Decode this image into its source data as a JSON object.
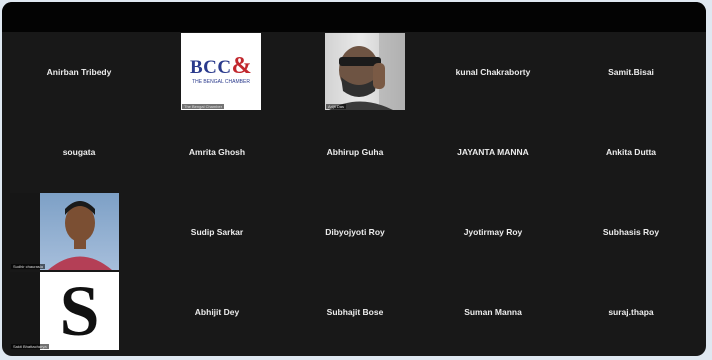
{
  "participants": [
    {
      "name": "Anirban Tribedy"
    },
    {
      "name": "",
      "caption": "The Bengal Chamber",
      "logo_text": "BCC",
      "logo_sub": "THE BENGAL CHAMBER"
    },
    {
      "name": "",
      "caption": "Arijit Das"
    },
    {
      "name": "kunal Chakraborty"
    },
    {
      "name": "Samit.Bisai"
    },
    {
      "name": "sougata"
    },
    {
      "name": "Amrita Ghosh"
    },
    {
      "name": "Abhirup Guha"
    },
    {
      "name": "JAYANTA MANNA"
    },
    {
      "name": "Ankita Dutta"
    },
    {
      "name": "",
      "caption": "Sudhir chaurasia"
    },
    {
      "name": "Sudip Sarkar"
    },
    {
      "name": "Dibyojyoti Roy"
    },
    {
      "name": "Jyotirmay Roy"
    },
    {
      "name": "Subhasis Roy"
    },
    {
      "name": "",
      "caption": "Sakti Bhattacharya",
      "letter": "S"
    },
    {
      "name": "Abhijit Dey"
    },
    {
      "name": "Subhajit Bose"
    },
    {
      "name": "Suman Manna"
    },
    {
      "name": "suraj.thapa"
    }
  ],
  "colors": {
    "background": "#181818",
    "topbar": "#030303",
    "name_text": "#ececec",
    "bcc_logo_red": "#c1272d",
    "bcc_logo_blue": "#2a3a8c"
  }
}
